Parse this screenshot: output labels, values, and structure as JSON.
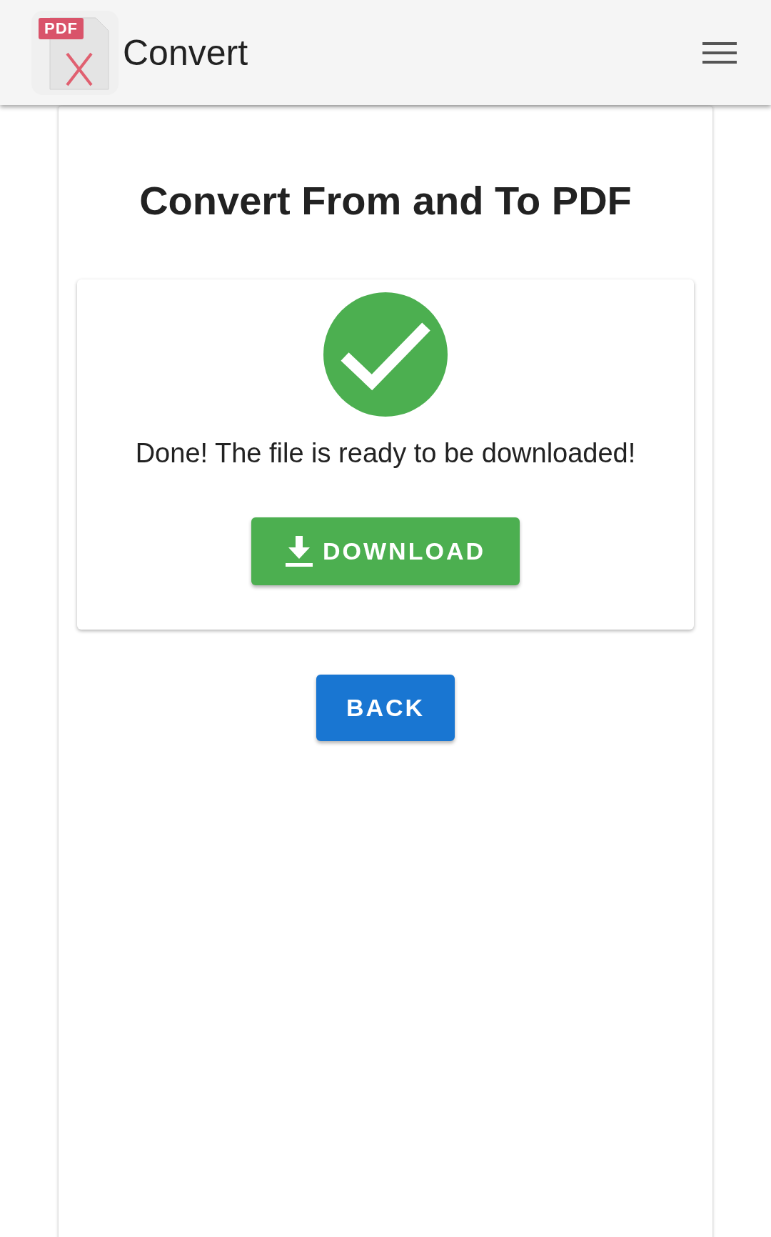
{
  "app_bar": {
    "logo_badge": "PDF",
    "title": "Convert"
  },
  "page": {
    "heading": "Convert From and To PDF",
    "result": {
      "kind": "success",
      "message": "Done! The file is ready to be downloaded!",
      "button": "DOWNLOAD"
    },
    "back_button": "BACK"
  }
}
